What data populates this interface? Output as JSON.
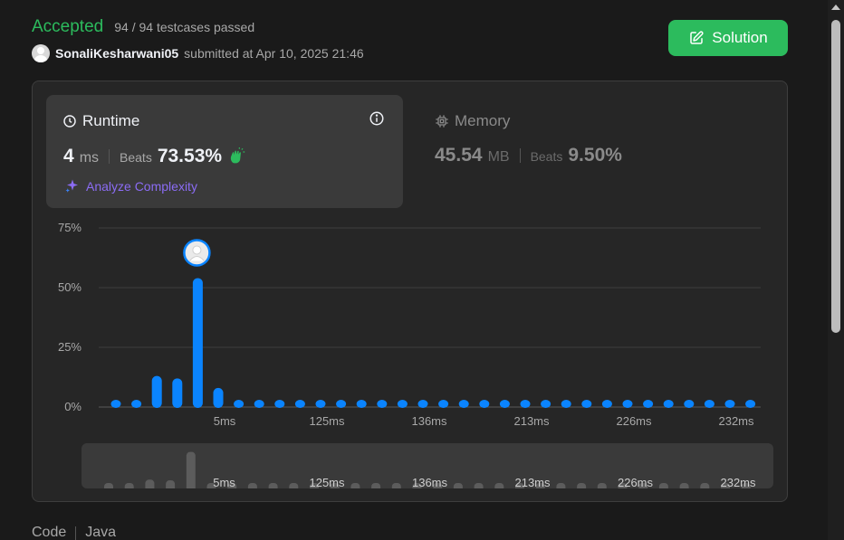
{
  "status": {
    "title": "Accepted",
    "testcases": "94 / 94 testcases passed"
  },
  "submission": {
    "username": "SonaliKesharwani05",
    "submitted_text": "submitted at Apr 10, 2025 21:46"
  },
  "solution_button": {
    "label": "Solution"
  },
  "runtime": {
    "title": "Runtime",
    "value": "4",
    "unit": "ms",
    "beats_label": "Beats",
    "beats_value": "73.53%",
    "analyze_label": "Analyze Complexity"
  },
  "memory": {
    "title": "Memory",
    "value": "45.54",
    "unit": "MB",
    "beats_label": "Beats",
    "beats_value": "9.50%"
  },
  "code_tabs": {
    "code": "Code",
    "language": "Java"
  },
  "colors": {
    "accent": "#2cbb5d",
    "bar": "#0a84ff",
    "purple": "#8b6cf4"
  },
  "chart_data": {
    "type": "bar",
    "ylabels": [
      "75%",
      "50%",
      "25%",
      "0%"
    ],
    "ylim": [
      0,
      75
    ],
    "xlabels": [
      {
        "index": 5,
        "text": "5ms"
      },
      {
        "index": 10,
        "text": "125ms"
      },
      {
        "index": 15,
        "text": "136ms"
      },
      {
        "index": 20,
        "text": "213ms"
      },
      {
        "index": 25,
        "text": "226ms"
      },
      {
        "index": 30,
        "text": "232ms"
      }
    ],
    "values": [
      1.5,
      1.5,
      13,
      12,
      54,
      8,
      1.5,
      1.5,
      1.5,
      1.5,
      1.5,
      1.5,
      1.5,
      1.5,
      1.5,
      1.5,
      1.5,
      1.5,
      1.5,
      1.5,
      1.5,
      1.5,
      1.5,
      1.5,
      1.5,
      1.5,
      1.5,
      1.5,
      1.5,
      1.5,
      1.5,
      1.5
    ],
    "highlight_index": 4,
    "grid": true
  }
}
